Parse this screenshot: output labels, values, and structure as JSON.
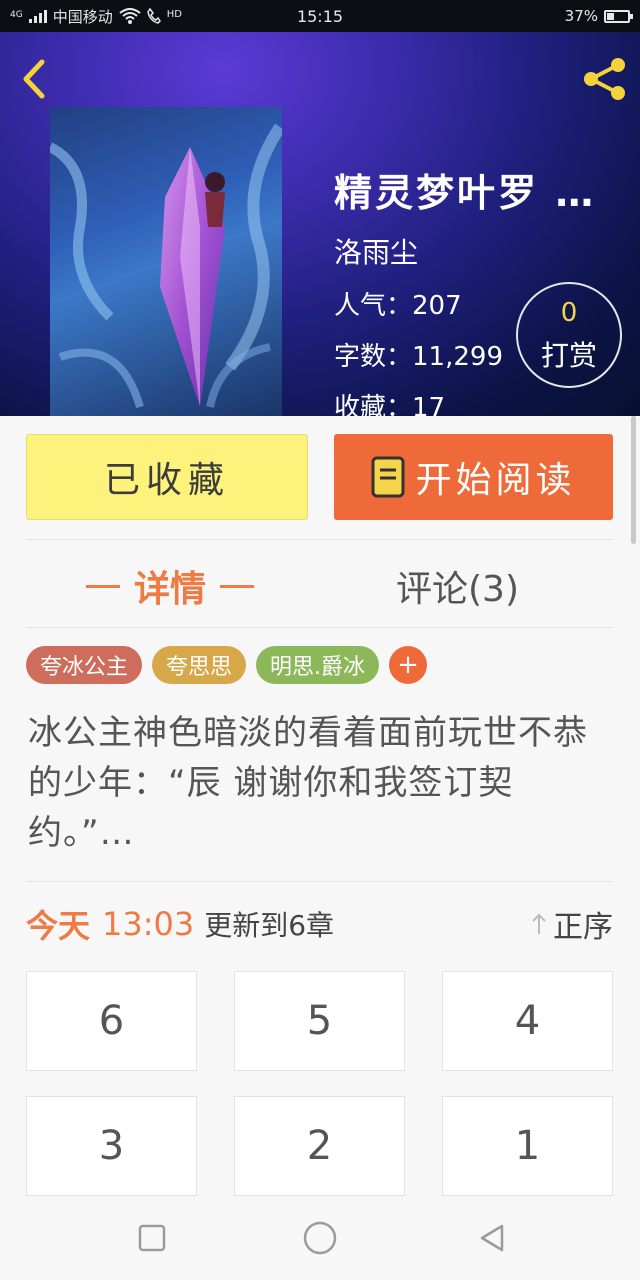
{
  "status_bar": {
    "network_badge": "4G",
    "carrier": "中国移动",
    "hd_badge": "HD",
    "time": "15:15",
    "battery_percent": "37%",
    "battery_level": 0.37
  },
  "book": {
    "title": "精灵梦叶罗 …",
    "author": "洛雨尘",
    "popularity_label": "人气：",
    "popularity": "207",
    "word_count_label": "字数：",
    "word_count": "11,299",
    "favorites_label": "收藏：",
    "favorites": "17",
    "reward_count": "0",
    "reward_label": "打赏"
  },
  "actions": {
    "collected_label": "已收藏",
    "read_label": "开始阅读"
  },
  "tabs": {
    "detail": "详情",
    "comments": "评论(3)"
  },
  "tags": [
    {
      "label": "夸冰公主",
      "color": "#cf6d5c"
    },
    {
      "label": "夸思思",
      "color": "#d7a84a"
    },
    {
      "label": "明思.爵冰",
      "color": "#8db85a"
    }
  ],
  "tag_add_label": "+",
  "summary": "冰公主神色暗淡的看着面前玩世不恭的少年：“辰 谢谢你和我签订契约。”…",
  "update": {
    "day": "今天",
    "time": "13:03",
    "text": "更新到6章",
    "sort_label": "正序"
  },
  "chapters": [
    "6",
    "5",
    "4",
    "3",
    "2",
    "1"
  ],
  "colors": {
    "accent_orange": "#ee6a38",
    "collected_yellow": "#fdf37c"
  },
  "icons": {
    "back": "chevron-left-icon",
    "share": "share-icon",
    "book": "book-icon",
    "sort": "arrow-up-icon",
    "nav_recent": "square-icon",
    "nav_home": "circle-icon",
    "nav_back": "triangle-back-icon"
  }
}
